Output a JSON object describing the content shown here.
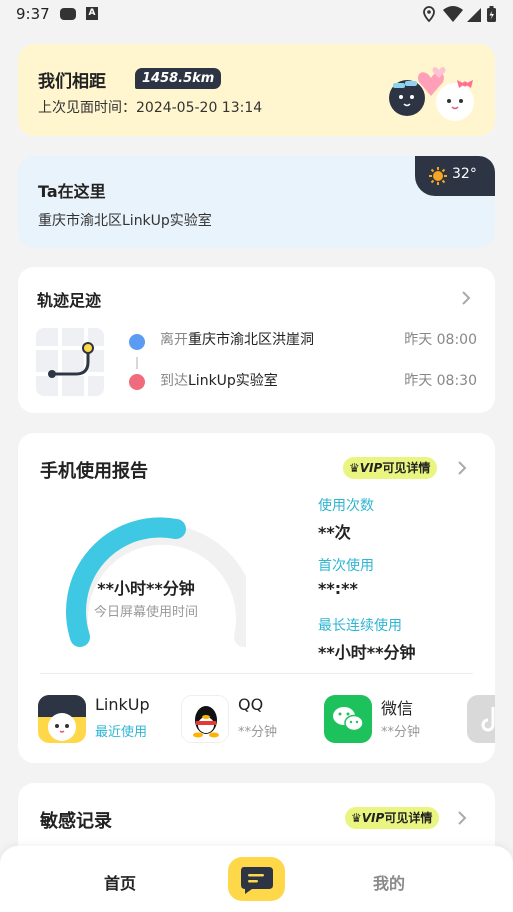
{
  "status_bar": {
    "time": "9:37",
    "icons": [
      "notification-dot-icon",
      "a-icon",
      "location-icon",
      "wifi-icon",
      "signal-icon",
      "battery-icon"
    ]
  },
  "distance_card": {
    "title": "我们相距",
    "distance": "1458.5km",
    "last_meet_label": "上次见面时间：",
    "last_meet_time": "2024-05-20 13:14"
  },
  "location_card": {
    "title": "Ta在这里",
    "address": "重庆市渝北区LinkUp实验室",
    "weather_icon": "sun-icon",
    "temperature": "32°"
  },
  "track_card": {
    "title": "轨迹足迹",
    "events": [
      {
        "verb": "离开",
        "place": "重庆市渝北区洪崖洞",
        "time": "昨天 08:00",
        "color": "#5b9cf2"
      },
      {
        "verb": "到达",
        "place": "LinkUp实验室",
        "time": "昨天 08:30",
        "color": "#f06b7c"
      }
    ]
  },
  "usage_card": {
    "title": "手机使用报告",
    "vip_label": "VIP",
    "vip_text": "可见详情",
    "screen_time_value": "**小时**分钟",
    "screen_time_label": "今日屏幕使用时间",
    "stats": [
      {
        "label": "使用次数",
        "value": "**次"
      },
      {
        "label": "首次使用",
        "value": "**:**"
      },
      {
        "label": "最长连续使用",
        "value": "**小时**分钟"
      }
    ],
    "apps": [
      {
        "name": "LinkUp",
        "sub": "最近使用",
        "icon": "linkup-app-icon"
      },
      {
        "name": "QQ",
        "sub": "**分钟",
        "icon": "qq-app-icon"
      },
      {
        "name": "微信",
        "sub": "**分钟",
        "icon": "wechat-app-icon"
      },
      {
        "name": "",
        "sub": "",
        "icon": "tiktok-app-icon"
      }
    ],
    "accent_color": "#3ec8e4"
  },
  "sensitive_card": {
    "title": "敏感记录",
    "vip_label": "VIP",
    "vip_text": "可见详情"
  },
  "bottom_nav": {
    "home_label": "首页",
    "mine_label": "我的",
    "center_icon": "chat-icon"
  }
}
